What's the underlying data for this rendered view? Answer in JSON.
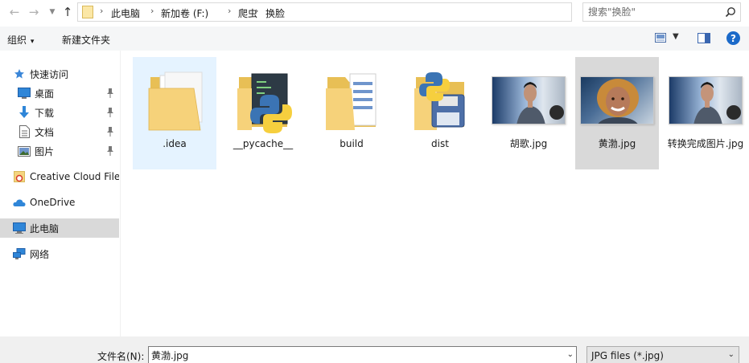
{
  "address_bar": {
    "breadcrumbs": [
      "此电脑",
      "新加卷 (F:)",
      "爬虫",
      "换脸"
    ],
    "search_placeholder": "搜索\"换脸\""
  },
  "toolbar": {
    "organize_label": "组织",
    "new_folder_label": "新建文件夹"
  },
  "sidebar": {
    "items": [
      {
        "label": "快速访问",
        "icon": "star-icon"
      },
      {
        "label": "桌面",
        "icon": "desktop-icon",
        "pinned": true
      },
      {
        "label": "下载",
        "icon": "download-icon",
        "pinned": true
      },
      {
        "label": "文档",
        "icon": "document-icon",
        "pinned": true
      },
      {
        "label": "图片",
        "icon": "pictures-icon",
        "pinned": true
      },
      {
        "label": "Creative Cloud Files",
        "icon": "creative-cloud-icon"
      },
      {
        "label": "OneDrive",
        "icon": "onedrive-icon"
      },
      {
        "label": "此电脑",
        "icon": "this-pc-icon",
        "selected": true
      },
      {
        "label": "网络",
        "icon": "network-icon"
      }
    ]
  },
  "files": [
    {
      "name": ".idea",
      "type": "folder",
      "state": "hover"
    },
    {
      "name": "__pycache__",
      "type": "python-folder"
    },
    {
      "name": "build",
      "type": "folder-docs"
    },
    {
      "name": "dist",
      "type": "python-folder-disk"
    },
    {
      "name": "胡歌.jpg",
      "type": "image"
    },
    {
      "name": "黄渤.jpg",
      "type": "image",
      "state": "selected"
    },
    {
      "name": "转换完成图片.jpg",
      "type": "image"
    }
  ],
  "bottom_bar": {
    "filename_label": "文件名(N):",
    "filename_value": "黄渤.jpg",
    "filetype_label": "JPG files (*.jpg)"
  },
  "colors": {
    "accent": "#1b6ac9",
    "hover": "#e5f3ff",
    "selected": "#d9d9d9",
    "folder": "#f4d580"
  }
}
